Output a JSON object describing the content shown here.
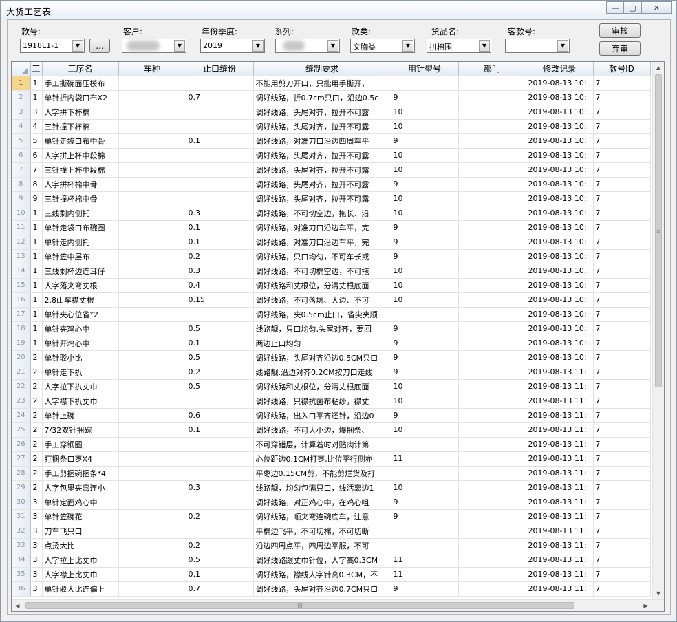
{
  "window": {
    "title": "大货工艺表",
    "minimize": "—",
    "maximize": "▢",
    "close": "✕"
  },
  "filters": {
    "style_no": {
      "label": "款号:",
      "value": "1918L1-1",
      "browse": "..."
    },
    "customer": {
      "label": "客户:",
      "value": ""
    },
    "year_season": {
      "label": "年份季度:",
      "value": "2019"
    },
    "series": {
      "label": "系列:",
      "value": ""
    },
    "category": {
      "label": "款类:",
      "value": "文胸类"
    },
    "product_name": {
      "label": "货品名:",
      "value": "拼棉围"
    },
    "customer_style_no": {
      "label": "客款号:",
      "value": ""
    }
  },
  "buttons": {
    "approve": "审核",
    "unapprove": "弃审"
  },
  "grid": {
    "columns": [
      "工",
      "工序名",
      "车种",
      "止口缝份",
      "缝制要求",
      "用针型号",
      "部门",
      "修改记录",
      "款号ID"
    ],
    "rows": [
      [
        "1",
        "手工撕碗面压模布",
        "",
        "",
        "不能用剪刀开口，只能用手撕开，",
        "",
        "",
        "2019-08-13 10:",
        "7"
      ],
      [
        "1",
        "单针折内袋口布X2",
        "",
        "0.7",
        "调好线路，折0.7cm只口，沿边0.5c",
        "9",
        "",
        "2019-08-13 10:",
        "7"
      ],
      [
        "3",
        "人字拼下杯棉",
        "",
        "",
        "调好线路，头尾对齐，拉开不可露",
        "10",
        "",
        "2019-08-13 10:",
        "7"
      ],
      [
        "4",
        "三针撞下杯棉",
        "",
        "",
        "调好线路，头尾对齐，拉开不可露",
        "10",
        "",
        "2019-08-13 10:",
        "7"
      ],
      [
        "5",
        "单针走袋口布中骨",
        "",
        "0.1",
        "调好线路，对准刀口沿边四周车平",
        "9",
        "",
        "2019-08-13 10:",
        "7"
      ],
      [
        "6",
        "人字拼上杯中段棉",
        "",
        "",
        "调好线路，头尾对齐，拉开不可露",
        "10",
        "",
        "2019-08-13 10:",
        "7"
      ],
      [
        "7",
        "三针撞上杯中段棉",
        "",
        "",
        "调好线路，头尾对齐，拉开不可露",
        "10",
        "",
        "2019-08-13 10:",
        "7"
      ],
      [
        "8",
        "人字拼杯棉中骨",
        "",
        "",
        "调好线路，头尾对齐，拉开不可露",
        "9",
        "",
        "2019-08-13 10:",
        "7"
      ],
      [
        "9",
        "三针撞杯棉中骨",
        "",
        "",
        "调好线路，头尾对齐，拉开不可露",
        "10",
        "",
        "2019-08-13 10:",
        "7"
      ],
      [
        "1",
        "三线剩内侧托",
        "",
        "0.3",
        "调好线路，不可切空边，拖长、沿",
        "10",
        "",
        "2019-08-13 10:",
        "7"
      ],
      [
        "1",
        "单针走袋口布碗圈",
        "",
        "0.1",
        "调好线路，对准刀口沿边车平，完",
        "9",
        "",
        "2019-08-13 10:",
        "7"
      ],
      [
        "1",
        "单针走内侧托",
        "",
        "0.1",
        "调好线路，对准刀口沿边车平，完",
        "9",
        "",
        "2019-08-13 10:",
        "7"
      ],
      [
        "1",
        "单针笠中层布",
        "",
        "0.2",
        "调好线路，只口均匀，不可车长或",
        "9",
        "",
        "2019-08-13 10:",
        "7"
      ],
      [
        "1",
        "三线剩杯边连耳仔",
        "",
        "0.3",
        "调好线路，不可切棉空边，不可拖",
        "10",
        "",
        "2019-08-13 10:",
        "7"
      ],
      [
        "1",
        "人字落夹弯丈根",
        "",
        "0.4",
        "调好线路和丈根位，分清丈根底面",
        "10",
        "",
        "2019-08-13 10:",
        "7"
      ],
      [
        "1",
        "2.8山车襟丈根",
        "",
        "0.15",
        "调好线路，不可落坑、大边、不可",
        "10",
        "",
        "2019-08-13 10:",
        "7"
      ],
      [
        "1",
        "单针夹心位省*2",
        "",
        "",
        "调好线路，夹0.5cm止口，省尖夹顺",
        "",
        "",
        "2019-08-13 10:",
        "7"
      ],
      [
        "1",
        "单针夹鸡心中",
        "",
        "0.5",
        "线路靓，只口均匀,头尾对齐，要回",
        "9",
        "",
        "2019-08-13 10:",
        "7"
      ],
      [
        "1",
        "单针开鸡心中",
        "",
        "0.1",
        "两边止口均匀",
        "9",
        "",
        "2019-08-13 10:",
        "7"
      ],
      [
        "2",
        "单针驳小比",
        "",
        "0.5",
        "调好线路，头尾对齐沿边0.5CM只口",
        "9",
        "",
        "2019-08-13 10:",
        "7"
      ],
      [
        "2",
        "单针走下扒",
        "",
        "0.2",
        "线路靓.沿边对齐0.2CM按刀口走线",
        "9",
        "",
        "2019-08-13 11:",
        "7"
      ],
      [
        "2",
        "人字拉下扒丈巾",
        "",
        "0.5",
        "调好线路和丈根位，分清丈根底面",
        "10",
        "",
        "2019-08-13 11:",
        "7"
      ],
      [
        "2",
        "人字襟下扒丈巾",
        "",
        "",
        "调好线路，只襟抗菌布粘纱，襟丈",
        "10",
        "",
        "2019-08-13 11:",
        "7"
      ],
      [
        "2",
        "单针上碗",
        "",
        "0.6",
        "调好线路，出入口平齐还针，沿边0",
        "9",
        "",
        "2019-08-13 11:",
        "7"
      ],
      [
        "2",
        "7/32双针捆碗",
        "",
        "0.1",
        "调好线路，不可大小边，爆捆条、",
        "10",
        "",
        "2019-08-13 11:",
        "7"
      ],
      [
        "2",
        "手工穿钢圈",
        "",
        "",
        "不可穿错层，计算着时对贴肉计第",
        "",
        "",
        "2019-08-13 11:",
        "7"
      ],
      [
        "2",
        "打捆条口枣X4",
        "",
        "",
        "心位距边0.1CM打枣,比位平行侧亦",
        "11",
        "",
        "2019-08-13 11:",
        "7"
      ],
      [
        "2",
        "手工剪捆碗捆条*4",
        "",
        "",
        "平枣边0.15CM剪，不能剪烂货及打",
        "",
        "",
        "2019-08-13 11:",
        "7"
      ],
      [
        "2",
        "人字包里夹弯连小",
        "",
        "0.3",
        "线路靓，均匀包满只口，线活离边1",
        "10",
        "",
        "2019-08-13 11:",
        "7"
      ],
      [
        "3",
        "单针定面鸡心中",
        "",
        "",
        "调好线路，对正鸡心中，在鸡心咀",
        "9",
        "",
        "2019-08-13 11:",
        "7"
      ],
      [
        "3",
        "单针笠碗花",
        "",
        "0.2",
        "调好线路，顺夹弯连碗底车，注意",
        "9",
        "",
        "2019-08-13 11:",
        "7"
      ],
      [
        "3",
        "刀车飞只口",
        "",
        "",
        "平棉边飞平，不可切棉，不可切断",
        "",
        "",
        "2019-08-13 11:",
        "7"
      ],
      [
        "3",
        "点烫大比",
        "",
        "0.2",
        "沿边四周点平，四周边平服，不可",
        "",
        "",
        "2019-08-13 11:",
        "7"
      ],
      [
        "3",
        "人字拉上比丈巾",
        "",
        "0.5",
        "调好线路跟丈巾针位，人字高0.3CM",
        "11",
        "",
        "2019-08-13 11:",
        "7"
      ],
      [
        "3",
        "人字襟上比丈巾",
        "",
        "0.1",
        "调好线路，襟线人字针高0.3CM，不",
        "11",
        "",
        "2019-08-13 11:",
        "7"
      ],
      [
        "3",
        "单针驳大比连偏上",
        "",
        "0.7",
        "调好线路，头尾对齐沿边0.7CM只口",
        "9",
        "",
        "2019-08-13 11:",
        "7"
      ]
    ]
  },
  "scroll_glyphs": {
    "up": "▲",
    "down": "▼",
    "left": "◀",
    "right": "▶",
    "grip_v": "≡",
    "grip_h": "|||"
  }
}
